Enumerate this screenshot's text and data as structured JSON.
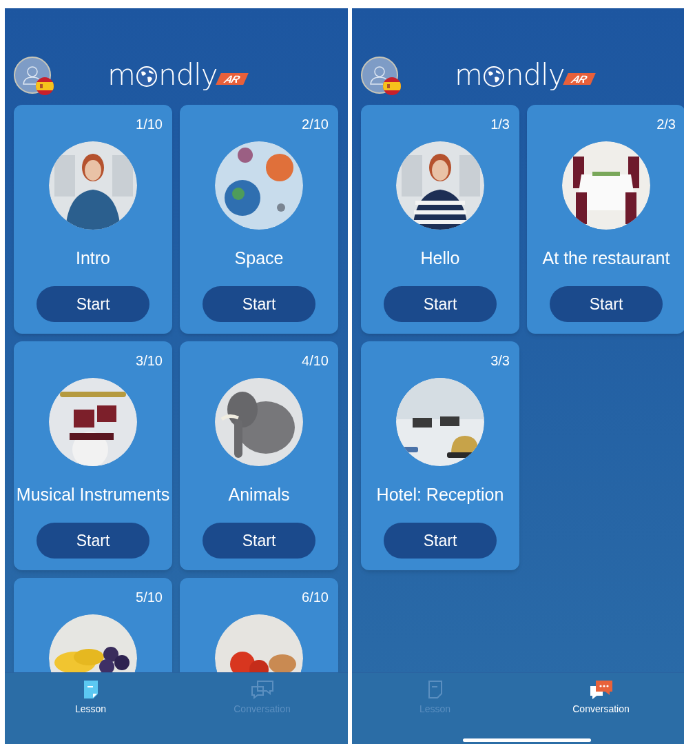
{
  "screens": [
    {
      "logo": {
        "start": "m",
        "end": "ndly",
        "badge": "AR"
      },
      "cards": [
        {
          "counter": "1/10",
          "title": "Intro",
          "button": "Start"
        },
        {
          "counter": "2/10",
          "title": "Space",
          "button": "Start"
        },
        {
          "counter": "3/10",
          "title": "Musical Instruments",
          "button": "Start"
        },
        {
          "counter": "4/10",
          "title": "Animals",
          "button": "Start"
        },
        {
          "counter": "5/10"
        },
        {
          "counter": "6/10"
        }
      ],
      "nav": [
        {
          "label": "Lesson",
          "kind": "lesson",
          "selected": true
        },
        {
          "label": "Conversation",
          "kind": "conversation",
          "selected": false
        }
      ]
    },
    {
      "logo": {
        "start": "m",
        "end": "ndly",
        "badge": "AR"
      },
      "cards": [
        {
          "counter": "1/3",
          "title": "Hello",
          "button": "Start"
        },
        {
          "counter": "2/3",
          "title": "At the restaurant",
          "button": "Start"
        },
        {
          "counter": "3/3",
          "title": "Hotel: Reception",
          "button": "Start"
        }
      ],
      "nav": [
        {
          "label": "Lesson",
          "kind": "lesson",
          "selected": false
        },
        {
          "label": "Conversation",
          "kind": "conversation",
          "selected": true
        }
      ],
      "home_indicator": true
    }
  ]
}
